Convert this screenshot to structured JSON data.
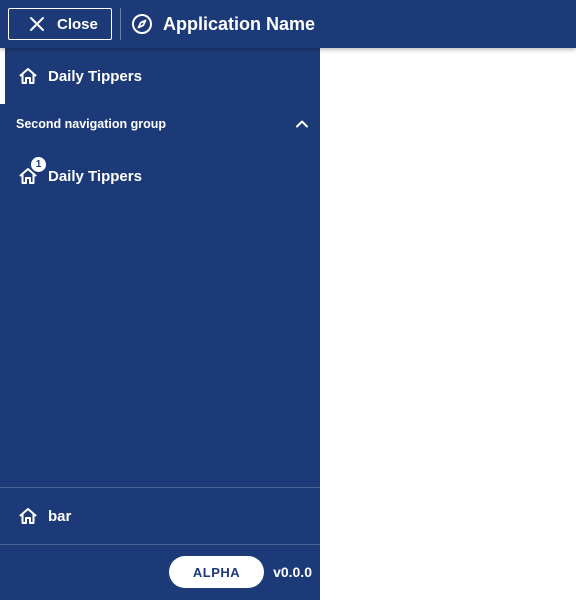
{
  "header": {
    "close_label": "Close",
    "app_name": "Application Name"
  },
  "sidebar": {
    "primary_item": {
      "label": "Daily Tippers",
      "icon": "home-icon",
      "active": true
    },
    "group": {
      "label": "Second navigation group",
      "expanded": true,
      "items": [
        {
          "label": "Daily Tippers",
          "icon": "home-icon",
          "badge": "1"
        }
      ]
    },
    "bottom_item": {
      "label": "bar",
      "icon": "home-icon"
    },
    "footer": {
      "stage": "ALPHA",
      "version": "v0.0.0"
    }
  },
  "colors": {
    "primary": "#1d3a78",
    "on_primary": "#ffffff"
  }
}
